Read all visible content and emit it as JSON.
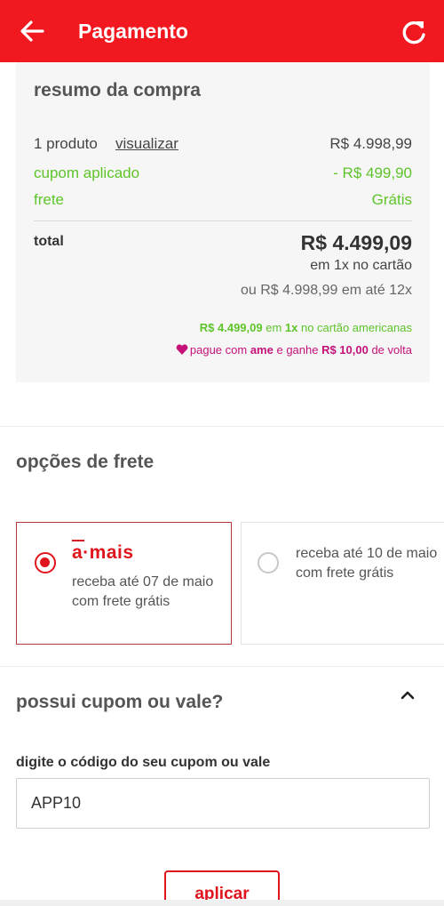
{
  "header": {
    "title": "Pagamento",
    "back_icon": "arrow-left-icon",
    "refresh_icon": "refresh-icon",
    "color": "#f2181f"
  },
  "summary": {
    "heading": "resumo da compra",
    "products_label": "1 produto",
    "view_link": "visualizar",
    "products_value": "R$ 4.998,99",
    "coupon_label": "cupom aplicado",
    "coupon_value": "- R$ 499,90",
    "shipping_label": "frete",
    "shipping_value": "Grátis",
    "total_label": "total",
    "total_value": "R$ 4.499,09",
    "total_sub1": "em 1x no cartão",
    "total_sub2": "ou R$ 4.998,99 em até 12x",
    "promo_card": {
      "amount": "R$ 4.499,09",
      "mid": " em ",
      "installments": "1x",
      "rest": " no cartão americanas"
    },
    "promo_ame": {
      "pre": "pague com ",
      "brand": "ame",
      "mid": " e ganhe ",
      "amount": "R$ 10,00",
      "post": " de volta"
    },
    "green_color": "#5ec42a",
    "ame_color": "#c4127a"
  },
  "shipping": {
    "title": "opções de frete",
    "options": [
      {
        "logo": "a·mais",
        "text": "receba até 07 de maio com frete grátis",
        "selected": true
      },
      {
        "text": "receba até 10 de maio com frete grátis",
        "selected": false
      }
    ]
  },
  "coupon": {
    "title": "possui cupom ou vale?",
    "chevron_icon": "chevron-up-icon",
    "field_label": "digite o código do seu cupom ou vale",
    "field_value": "APP10",
    "apply_label": "aplicar",
    "accent": "#e0141c"
  }
}
